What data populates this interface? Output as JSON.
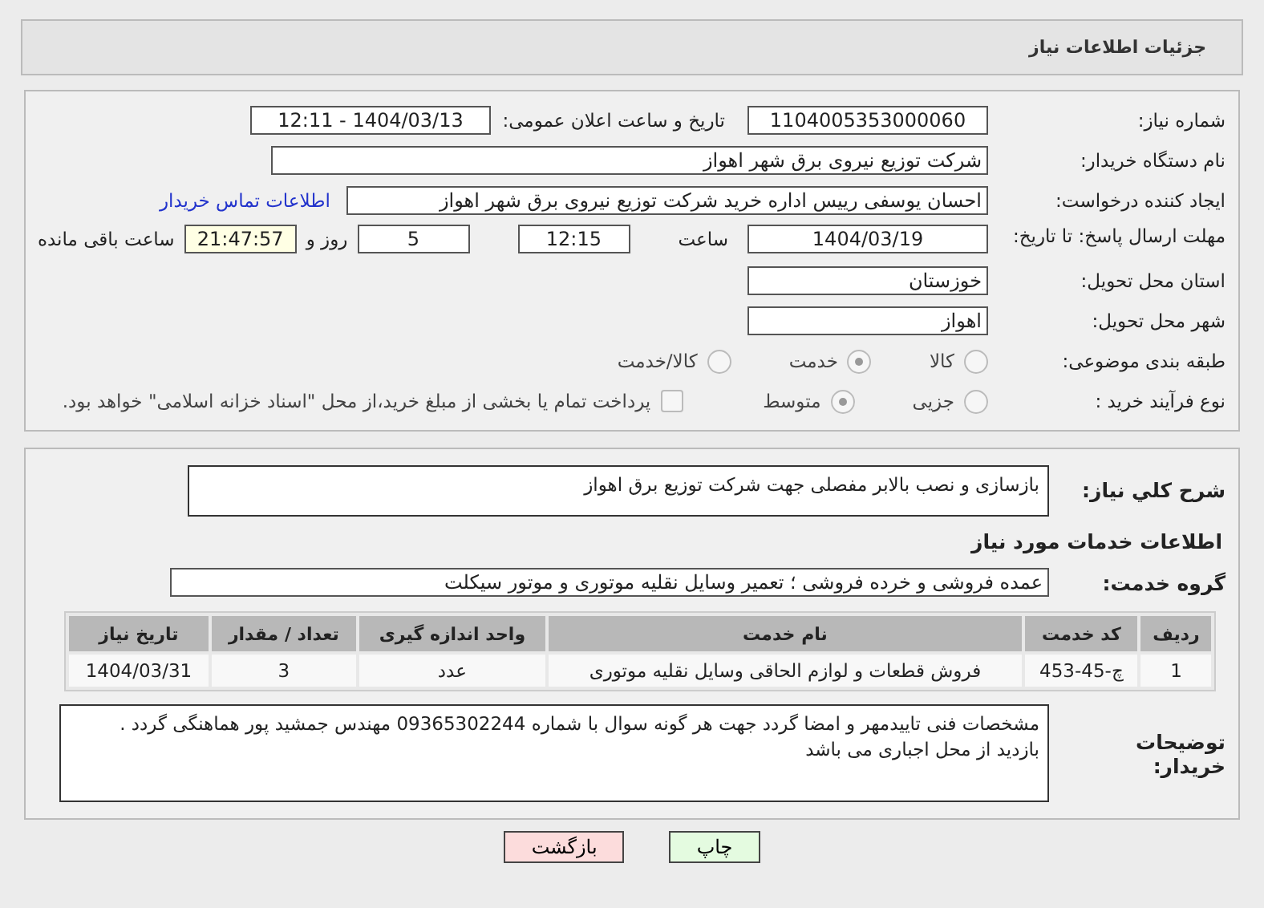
{
  "header": {
    "title": "جزئیات اطلاعات نیاز"
  },
  "need_number": {
    "label": "شماره نیاز:",
    "value": "1104005353000060"
  },
  "announce": {
    "label": "تاریخ و ساعت اعلان عمومی:",
    "value": "1404/03/13 - 12:11"
  },
  "buyer": {
    "label": "نام دستگاه خریدار:",
    "value": "شرکت توزیع نیروی برق شهر اهواز"
  },
  "creator": {
    "label": "ایجاد کننده درخواست:",
    "value": "احسان یوسفی رییس اداره خرید شرکت توزیع نیروی برق شهر اهواز",
    "link": "اطلاعات تماس خریدار"
  },
  "deadline": {
    "label": "مهلت ارسال پاسخ: تا تاریخ:",
    "date": "1404/03/19",
    "time_label": "ساعت",
    "time": "12:15",
    "days": "5",
    "days_label": "روز و",
    "remaining": "21:47:57",
    "remaining_label": "ساعت باقی مانده"
  },
  "province": {
    "label": "استان محل تحویل:",
    "value": "خوزستان"
  },
  "city": {
    "label": "شهر محل تحویل:",
    "value": "اهواز"
  },
  "category": {
    "label": "طبقه بندی موضوعی:",
    "options": [
      {
        "label": "کالا",
        "selected": false
      },
      {
        "label": "خدمت",
        "selected": true
      },
      {
        "label": "کالا/خدمت",
        "selected": false
      }
    ]
  },
  "process": {
    "label": "نوع فرآیند خرید :",
    "options": [
      {
        "label": "جزیی",
        "selected": false
      },
      {
        "label": "متوسط",
        "selected": true
      }
    ],
    "payment": {
      "label": "پرداخت تمام یا بخشی از مبلغ خرید،از محل \"اسناد خزانه اسلامی\" خواهد بود.",
      "checked": false
    }
  },
  "summary": {
    "label": "شرح کلي نیاز:",
    "value": "بازسازی و نصب بالابر مفصلی جهت شرکت توزیع برق اهواز"
  },
  "services": {
    "title": "اطلاعات خدمات مورد نیاز",
    "group_label": "گروه خدمت:",
    "group": "عمده فروشی و خرده فروشی ؛ تعمیر وسایل نقلیه موتوری و موتور سیکلت"
  },
  "table": {
    "columns": [
      "ردیف",
      "کد خدمت",
      "نام خدمت",
      "واحد اندازه گیری",
      "تعداد / مقدار",
      "تاریخ نیاز"
    ],
    "rows": [
      [
        "1",
        "چ-45-453",
        "فروش قطعات و لوازم الحاقی وسایل نقلیه موتوری",
        "عدد",
        "3",
        "1404/03/31"
      ]
    ]
  },
  "notes": {
    "label": "توضیحات خریدار:",
    "value": "مشخصات فنی تاییدمهر و امضا گردد جهت هر گونه سوال با شماره 09365302244 مهندس جمشید پور هماهنگی گردد .\nبازدید از محل اجباری می باشد"
  },
  "buttons": [
    {
      "label": "چاپ",
      "kind": "print"
    },
    {
      "label": "بازگشت",
      "kind": "back"
    }
  ]
}
